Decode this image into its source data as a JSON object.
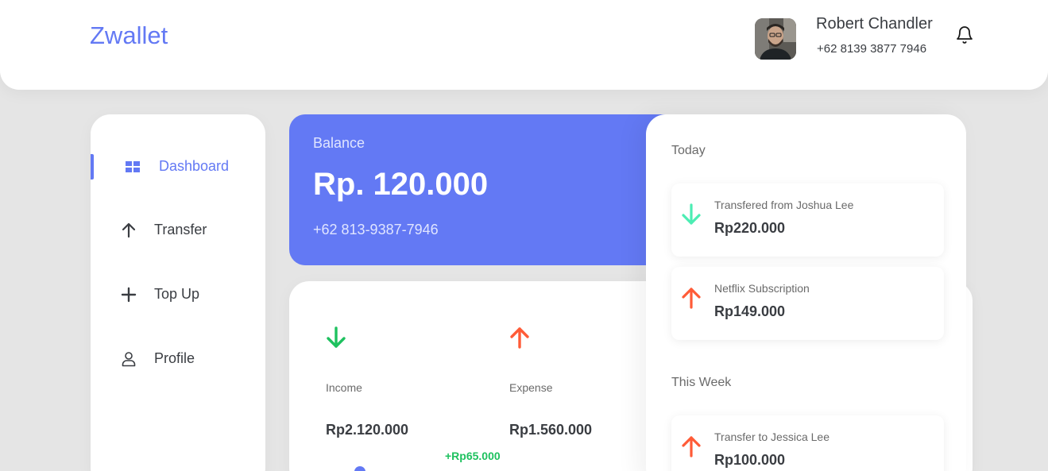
{
  "header": {
    "brand": "Zwallet",
    "user_name": "Robert Chandler",
    "user_phone": "+62 8139 3877 7946",
    "icons": {
      "avatar": "user-avatar",
      "bell": "bell-icon"
    }
  },
  "sidebar": {
    "items": [
      {
        "label": "Dashboard",
        "icon": "grid-icon",
        "active": true
      },
      {
        "label": "Transfer",
        "icon": "arrow-up-icon",
        "active": false
      },
      {
        "label": "Top Up",
        "icon": "plus-icon",
        "active": false
      },
      {
        "label": "Profile",
        "icon": "user-icon",
        "active": false
      }
    ]
  },
  "balance": {
    "label": "Balance",
    "amount": "Rp. 120.000",
    "phone": "+62 813-9387-7946"
  },
  "stats": {
    "income": {
      "label": "Income",
      "value": "Rp2.120.000",
      "icon": "arrow-down-icon"
    },
    "expense": {
      "label": "Expense",
      "value": "Rp1.560.000",
      "icon": "arrow-up-icon"
    },
    "chart_tooltip": "+Rp65.000"
  },
  "history": {
    "today_title": "Today",
    "today": [
      {
        "label": "Transfered from Joshua Lee",
        "amount": "Rp220.000",
        "direction": "in"
      },
      {
        "label": "Netflix Subscription",
        "amount": "Rp149.000",
        "direction": "out"
      }
    ],
    "week_title": "This Week",
    "week": [
      {
        "label": "Transfer to Jessica Lee",
        "amount": "Rp100.000",
        "direction": "out"
      }
    ]
  },
  "colors": {
    "primary": "#6379F4",
    "income": "#1EC15F",
    "income_light": "#4CEDB3",
    "expense": "#FF5B37",
    "text": "#3A3D42",
    "muted": "#6A6A6A",
    "background": "#E5E5E5"
  }
}
